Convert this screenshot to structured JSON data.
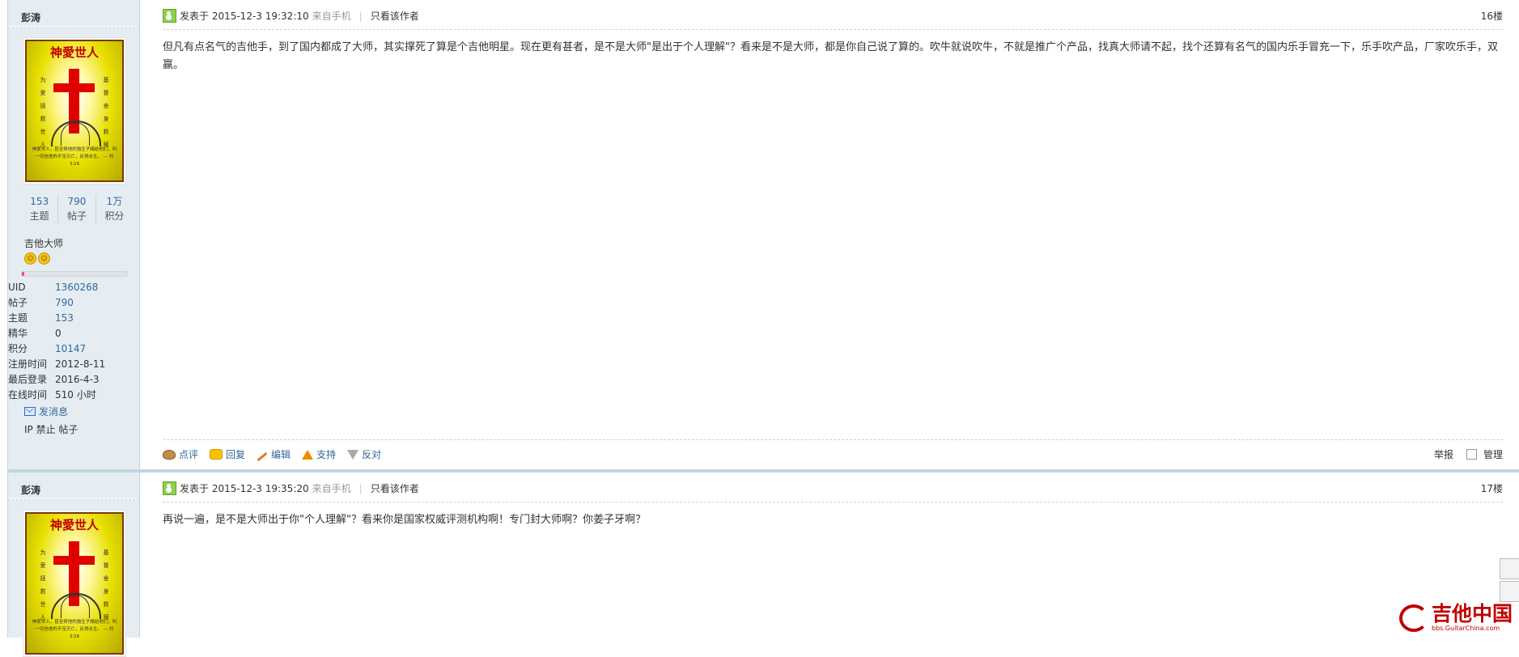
{
  "posts": [
    {
      "author": "彭涛",
      "avatar": {
        "title": "神愛世人",
        "left_col": "为 爱 拯 救 世 人",
        "right_col": "基 督 舍 身 救 赎",
        "verse": "神爱世人，甚至将他的独生子赐给他们，叫一切信他的不至灭亡，反得永生。 — 约 3:16"
      },
      "stats": [
        {
          "num": "153",
          "label": "主题"
        },
        {
          "num": "790",
          "label": "帖子"
        },
        {
          "num": "1万",
          "label": "积分"
        }
      ],
      "rank": "吉他大师",
      "progress": 0.02,
      "info": [
        {
          "k": "UID",
          "v": "1360268",
          "link": true
        },
        {
          "k": "帖子",
          "v": "790",
          "link": true
        },
        {
          "k": "主题",
          "v": "153",
          "link": true
        },
        {
          "k": "精华",
          "v": "0",
          "link": false
        },
        {
          "k": "积分",
          "v": "10147",
          "link": true
        },
        {
          "k": "注册时间",
          "v": "2012-8-11",
          "link": false
        },
        {
          "k": "最后登录",
          "v": "2016-4-3",
          "link": false
        },
        {
          "k": "在线时间",
          "v": "510 小时",
          "link": false
        }
      ],
      "send_msg": "发消息",
      "ip_ban": "IP 禁止 帖子",
      "posted_prefix": "发表于 2015-12-3 19:32:10",
      "device": "来自手机",
      "only_author": "只看该作者",
      "floor": "16楼",
      "content": "但凡有点名气的吉他手，到了国内都成了大师，其实撑死了算是个吉他明星。现在更有甚者，是不是大师\"是出于个人理解\"？看来是不是大师，都是你自己说了算的。吹牛就说吹牛，不就是推广个产品，找真大师请不起，找个还算有名气的国内乐手冒充一下，乐手吹产品，厂家吹乐手，双赢。",
      "actions": [
        "点评",
        "回复",
        "编辑",
        "支持",
        "反对"
      ],
      "report": "举报",
      "manage": "管理"
    },
    {
      "author": "彭涛",
      "posted_prefix": "发表于 2015-12-3 19:35:20",
      "device": "来自手机",
      "only_author": "只看该作者",
      "floor": "17楼",
      "content": "再说一遍，是不是大师出于你\"个人理解\"？看来你是国家权威评测机构啊！专门封大师啊？你姜子牙啊？"
    }
  ],
  "site_logo": {
    "name": "吉他中国",
    "url": "bbs.GuitarChina.com"
  },
  "colors": {
    "sidebar_bg": "#e5edf2",
    "border": "#c2d5e3",
    "link": "#336699",
    "brand": "#c00000"
  }
}
